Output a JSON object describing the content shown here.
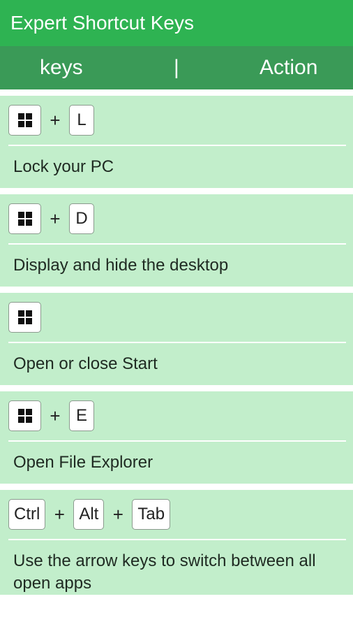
{
  "app": {
    "title": "Expert Shortcut Keys"
  },
  "header": {
    "keys_label": "keys",
    "separator": "|",
    "action_label": "Action"
  },
  "colors": {
    "appbar": "#2eb352",
    "header": "#3a9a57",
    "card": "#c2eecb"
  },
  "shortcuts": [
    {
      "k1": "windows-icon",
      "plus1": "+",
      "k2": "L",
      "desc": "Lock your PC"
    },
    {
      "k1": "windows-icon",
      "plus1": "+",
      "k2": "D",
      "desc": "Display and hide the desktop"
    },
    {
      "k1": "windows-icon",
      "desc": "Open or close Start"
    },
    {
      "k1": "windows-icon",
      "plus1": "+",
      "k2": "E",
      "desc": "Open File Explorer"
    },
    {
      "k1": "Ctrl",
      "plus1": "+",
      "k2": "Alt",
      "plus2": "+",
      "k3": "Tab",
      "desc": "Use the arrow keys to switch between all open apps"
    }
  ]
}
